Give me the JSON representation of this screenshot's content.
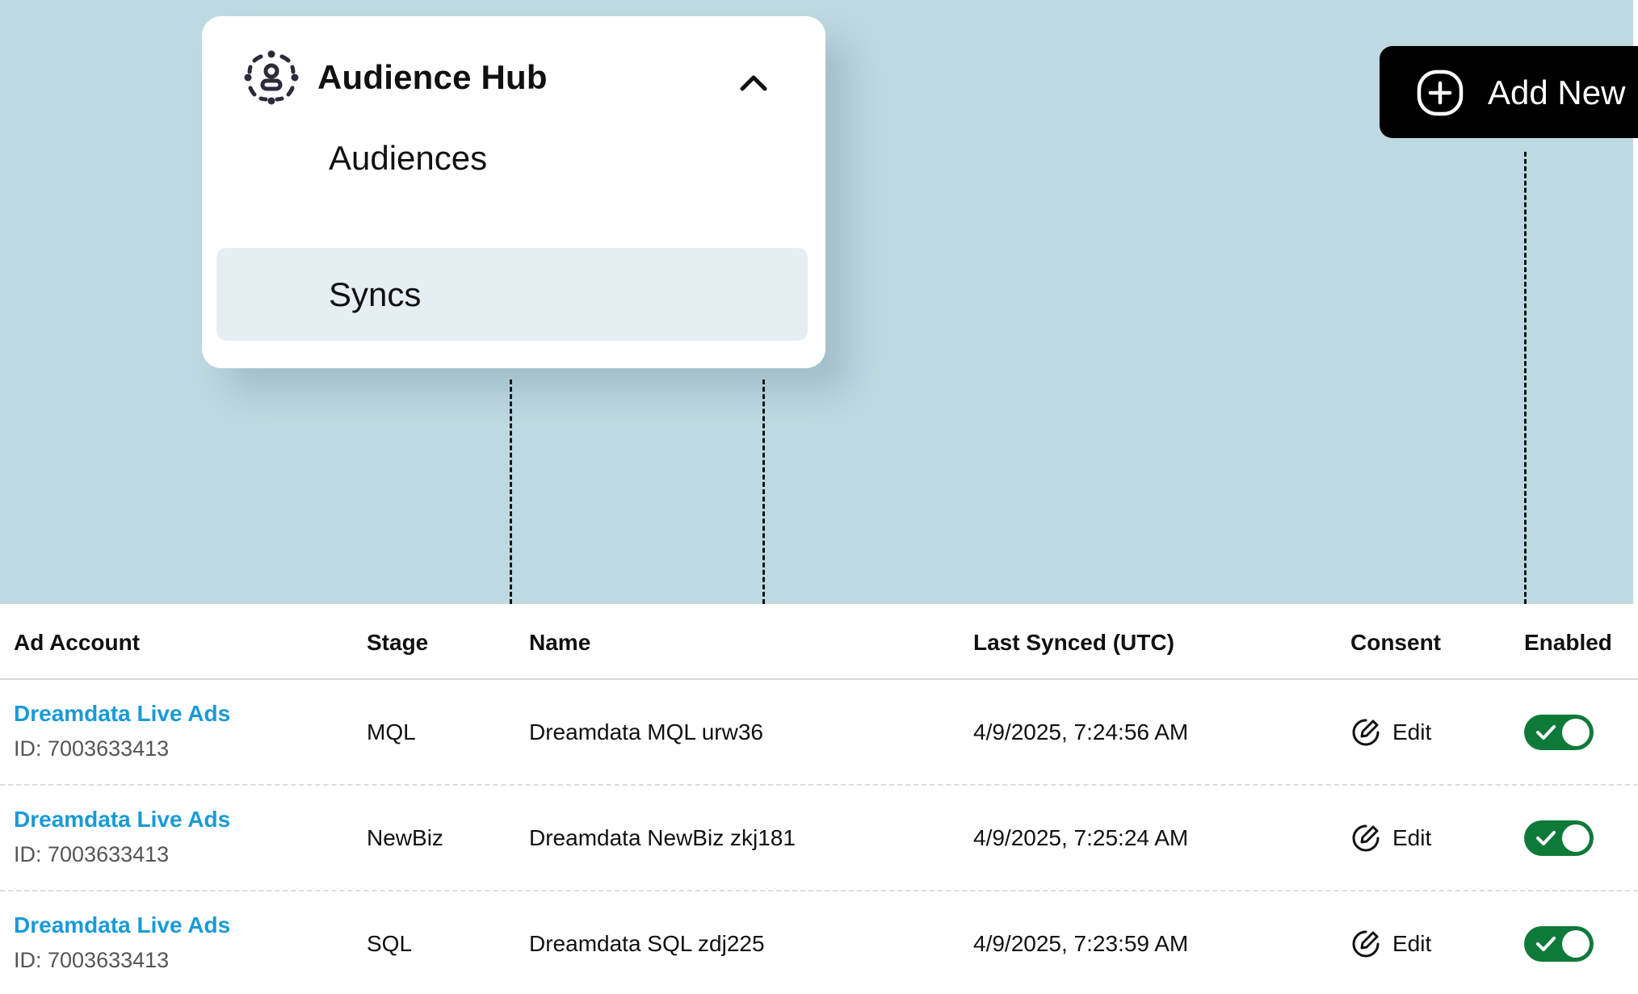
{
  "menu": {
    "title": "Audience Hub",
    "items": [
      {
        "label": "Audiences",
        "selected": false
      },
      {
        "label": "Syncs",
        "selected": true
      }
    ],
    "hub_icon": "audience-hub-icon",
    "collapse_icon": "chevron-up-icon"
  },
  "add_new": {
    "label": "Add New",
    "icon": "plus-circle-icon"
  },
  "table": {
    "headers": {
      "ad_account": "Ad Account",
      "stage": "Stage",
      "name": "Name",
      "last_synced": "Last Synced (UTC)",
      "consent": "Consent",
      "enabled": "Enabled"
    },
    "rows": [
      {
        "account_name": "Dreamdata Live Ads",
        "account_id": "ID: 7003633413",
        "stage": "MQL",
        "name": "Dreamdata MQL urw36",
        "last_synced": "4/9/2025, 7:24:56 AM",
        "consent_label": "Edit",
        "enabled": true
      },
      {
        "account_name": "Dreamdata Live Ads",
        "account_id": "ID: 7003633413",
        "stage": "NewBiz",
        "name": "Dreamdata NewBiz zkj181",
        "last_synced": "4/9/2025, 7:25:24 AM",
        "consent_label": "Edit",
        "enabled": true
      },
      {
        "account_name": "Dreamdata Live Ads",
        "account_id": "ID: 7003633413",
        "stage": "SQL",
        "name": "Dreamdata SQL zdj225",
        "last_synced": "4/9/2025, 7:23:59 AM",
        "consent_label": "Edit",
        "enabled": true
      }
    ]
  },
  "colors": {
    "background": "#bfd9e2",
    "link": "#1a9ad6",
    "toggle_on": "#0e7a3a",
    "selected_item": "#e5eef2",
    "button": "#000000"
  }
}
